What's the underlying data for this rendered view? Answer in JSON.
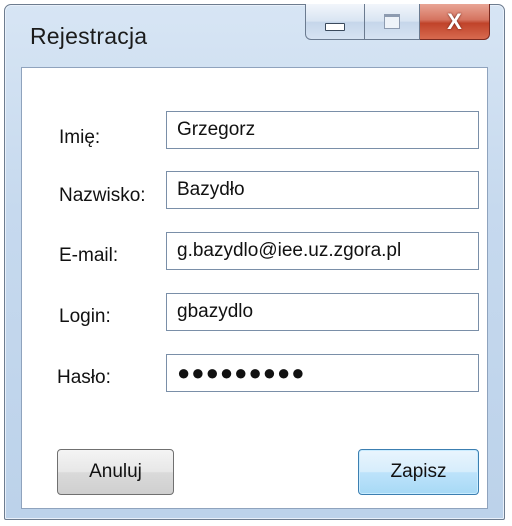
{
  "window": {
    "title": "Rejestracja",
    "controls": {
      "minimize_icon": "minimize-icon",
      "maximize_icon": "maximize-icon",
      "close_icon": "close-icon",
      "close_glyph": "X"
    }
  },
  "form": {
    "fields": [
      {
        "label": "Imię:",
        "value": "Grzegorz"
      },
      {
        "label": "Nazwisko:",
        "value": "Bazydło"
      },
      {
        "label": "E-mail:",
        "value": "g.bazydlo@iee.uz.zgora.pl"
      },
      {
        "label": "Login:",
        "value": "gbazydlo"
      },
      {
        "label": "Hasło:",
        "value": "●●●●●●●●●"
      }
    ]
  },
  "buttons": {
    "cancel": "Anuluj",
    "save": "Zapisz"
  },
  "colors": {
    "titlebar": "#c6d9ee",
    "close_button": "#c0432a",
    "save_button": "#bde3fb"
  }
}
